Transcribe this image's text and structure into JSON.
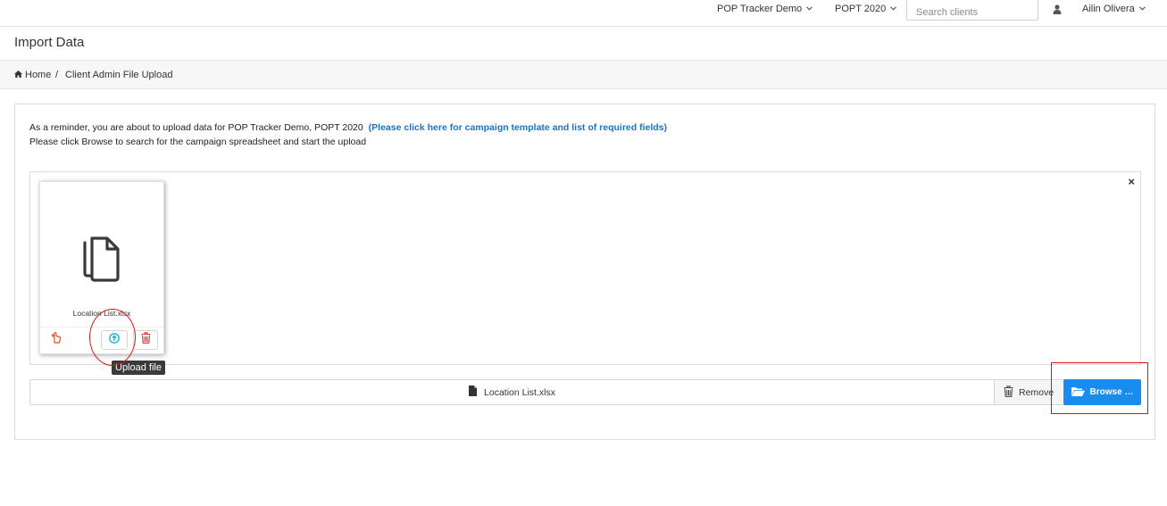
{
  "topbar": {
    "client_selector": "POP Tracker Demo",
    "campaign_selector": "POPT 2020",
    "search_placeholder": "Search clients",
    "user_name": "Ailin Olivera"
  },
  "page": {
    "title": "Import Data"
  },
  "breadcrumb": {
    "home": "Home",
    "separator": "/",
    "current": "Client Admin File Upload"
  },
  "reminder": {
    "line1": "As a reminder, you are about to upload data for POP Tracker Demo, POPT 2020",
    "link": "(Please click here for campaign template and list of required fields)",
    "line2": "Please click Browse to search for the campaign spreadsheet and start the upload"
  },
  "dropzone": {
    "close": "×",
    "file": {
      "name": "Location List.xlsx"
    },
    "tooltip": "Upload file"
  },
  "file_input": {
    "caption": "Location List.xlsx",
    "remove_label": "Remove",
    "browse_label": "Browse …"
  },
  "colors": {
    "browse": "#1a8cf0",
    "link": "#1a73c8",
    "annotation": "#e01010",
    "upload_icon": "#1fb5c9",
    "remove_icon": "#e03131"
  }
}
